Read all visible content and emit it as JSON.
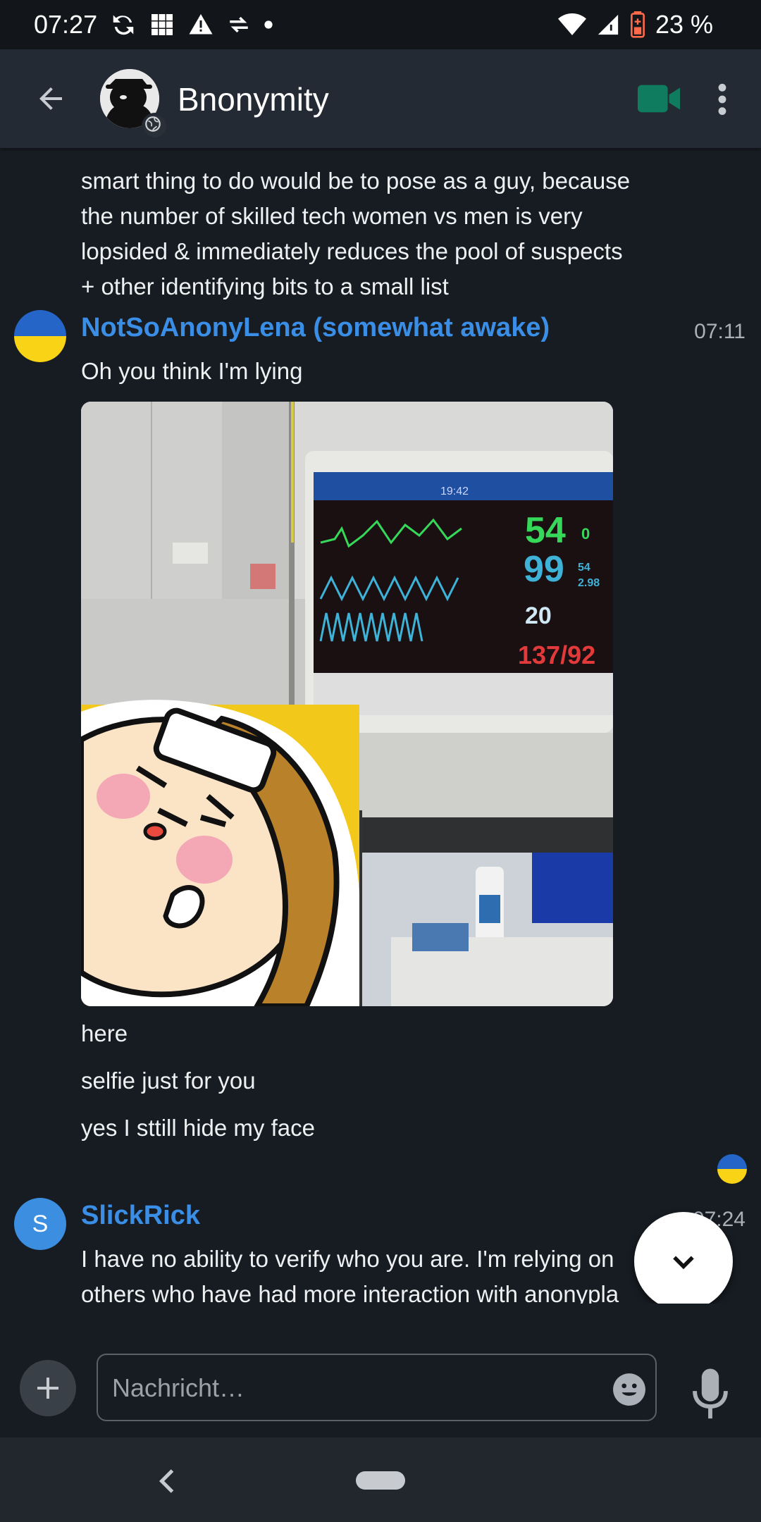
{
  "status_bar": {
    "time": "07:27",
    "battery_percent": "23 %"
  },
  "header": {
    "back_icon": "arrow-left-icon",
    "room_name": "Bnonymity",
    "video_icon": "video-camera-icon",
    "menu_icon": "more-vertical-icon"
  },
  "messages": [
    {
      "type": "text-continuation",
      "lines": [
        "smart thing to do would be to pose as a guy, because",
        "the number of skilled tech women vs men is very",
        "lopsided & immediately reduces the pool of suspects",
        "+ other identifying bits to a small list"
      ]
    },
    {
      "sender": "NotSoAnonyLena (somewhat awake)",
      "time": "07:11",
      "text": "Oh you think I'm lying",
      "image": {
        "monitor_values": [
          "54",
          "99",
          "20",
          "137/92",
          "0",
          "54",
          "2.98"
        ],
        "monitor_time": "19:42"
      },
      "followups": [
        "here",
        "selfie just for you",
        "yes I sttill hide my face"
      ]
    },
    {
      "sender": "SlickRick",
      "avatar_letter": "S",
      "time": "07:24",
      "lines": [
        "I have no ability to verify who you are. I'm relying on",
        "others who have had more interaction with anonypla"
      ]
    }
  ],
  "composer": {
    "placeholder": "Nachricht…"
  },
  "colors": {
    "accent": "#3b8ee6",
    "background": "#171c22",
    "appbar": "#232a33",
    "video_icon": "#0f7b5f"
  }
}
